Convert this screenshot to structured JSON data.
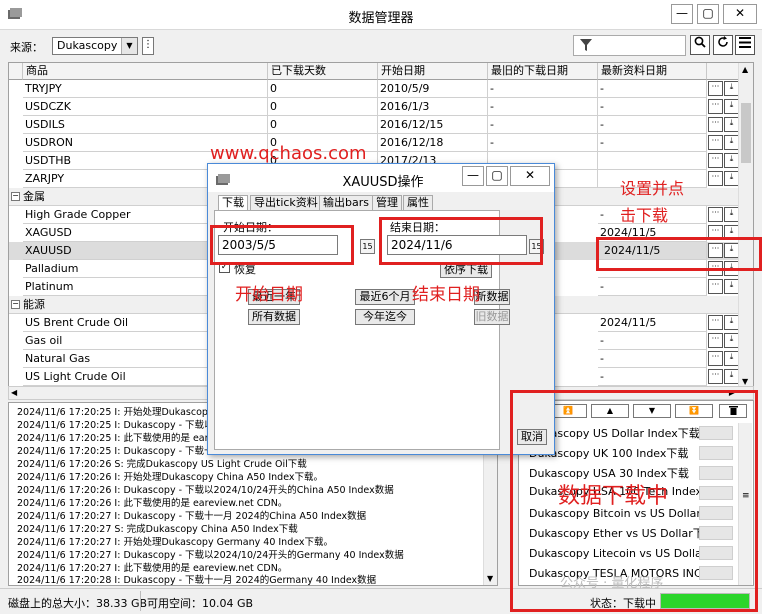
{
  "window": {
    "title": "数据管理器",
    "min": "—",
    "max": "▢",
    "close": "✕"
  },
  "toolbar": {
    "source_label": "来源：",
    "source_value": "Dukascopy",
    "filter_placeholder": ""
  },
  "grid": {
    "headers": [
      "商品",
      "已下载天数",
      "开始日期",
      "最旧的下载日期",
      "最新资料日期"
    ],
    "rows": [
      {
        "name": "TRYJPY",
        "days": "0",
        "start": "2010/5/9",
        "oldest": "-",
        "latest": "-"
      },
      {
        "name": "USDCZK",
        "days": "0",
        "start": "2016/1/3",
        "oldest": "-",
        "latest": "-"
      },
      {
        "name": "USDILS",
        "days": "0",
        "start": "2016/12/15",
        "oldest": "-",
        "latest": "-"
      },
      {
        "name": "USDRON",
        "days": "0",
        "start": "2016/12/18",
        "oldest": "-",
        "latest": "-"
      },
      {
        "name": "USDTHB",
        "days": "0",
        "start": "2017/2/13",
        "oldest": "",
        "latest": ""
      },
      {
        "name": "ZARJPY",
        "days": "",
        "start": "",
        "oldest": "",
        "latest": ""
      }
    ],
    "group_metal": "金属",
    "metal_rows": [
      {
        "name": "High Grade Copper",
        "latest": "-"
      },
      {
        "name": "XAGUSD",
        "latest": "2024/11/5"
      },
      {
        "name": "XAUUSD",
        "latest": "2024/11/5"
      },
      {
        "name": "Palladium",
        "latest": "-"
      },
      {
        "name": "Platinum",
        "latest": "-"
      }
    ],
    "group_energy": "能源",
    "energy_rows": [
      {
        "name": "US Brent Crude Oil",
        "latest": "2024/11/5"
      },
      {
        "name": "Gas oil",
        "latest": "-"
      },
      {
        "name": "Natural Gas",
        "latest": "-"
      },
      {
        "name": "US Light Crude Oil",
        "latest": "-"
      }
    ]
  },
  "dialog": {
    "title": "XAUUSD操作",
    "tabs": [
      "下载",
      "导出tick资料",
      "输出bars",
      "管理",
      "属性"
    ],
    "start_label": "开始日期：",
    "start_value": "2003/5/5",
    "end_label": "结束日期：",
    "end_value": "2024/11/6",
    "cal": "15",
    "restore_label": "恢复",
    "order_btn": "依序下载",
    "btn_last_year": "最近一年",
    "btn_last_6m": "最近6个月",
    "btn_new_data": "新数据",
    "btn_all": "所有数据",
    "btn_ytd": "今年迄今",
    "btn_old": "旧数据",
    "cancel": "取消"
  },
  "log": [
    "2024/11/6 17:20:25 I: 开始处理Dukascopy US",
    "2024/11/6 17:20:25 I: Dukascopy - 下载以20",
    "2024/11/6 17:20:25 I: 此下载使用的是 eare",
    "2024/11/6 17:20:25 I: Dukascopy - 下载十一",
    "2024/11/6 17:20:26 S: 完成Dukascopy US Light Crude Oil下载",
    "2024/11/6 17:20:26 I: 开始处理Dukascopy China A50 Index下载。",
    "2024/11/6 17:20:26 I: Dukascopy - 下载以2024/10/24开头的China A50 Index数据",
    "2024/11/6 17:20:26 I: 此下载使用的是 eareview.net CDN。",
    "2024/11/6 17:20:27 I: Dukascopy - 下载十一月 2024的China A50 Index数据",
    "2024/11/6 17:20:27 S: 完成Dukascopy China A50 Index下载",
    "2024/11/6 17:20:27 I: 开始处理Dukascopy Germany 40 Index下载。",
    "2024/11/6 17:20:27 I: Dukascopy - 下载以2024/10/24开头的Germany 40 Index数据",
    "2024/11/6 17:20:27 I: 此下载使用的是 eareview.net CDN。",
    "2024/11/6 17:20:28 I: Dukascopy - 下载十一月 2024的Germany 40 Index数据"
  ],
  "queue": [
    "Dukascopy US Dollar Index下载",
    "Dukascopy UK 100 Index下载",
    "Dukascopy USA 30 Index下载",
    "Dukascopy USA 100 Tech Index",
    "Dukascopy Bitcoin vs US Dollar下",
    "Dukascopy Ether vs US Dollar下载",
    "Dukascopy Litecoin vs US Dollar下",
    "Dukascopy TESLA MOTORS INC下"
  ],
  "status": {
    "disk_size": "磁盘上的总大小：38.33 GB",
    "free_space": "可用空间：10.04 GB",
    "state": "状态：下载中",
    "progress": 1.0,
    "progress_color": "#2bd52b"
  },
  "annotations": {
    "watermark_url": "www.qchaos.com",
    "set_click_1": "设置并点",
    "set_click_2": "击下载",
    "start_date": "开始日期",
    "end_date": "结束日期",
    "downloading": "数据下载中",
    "wechat": "公众号 · 量化程序"
  },
  "colors": {
    "annotation": "#e02020",
    "dialog_border": "#4a8ad8"
  }
}
